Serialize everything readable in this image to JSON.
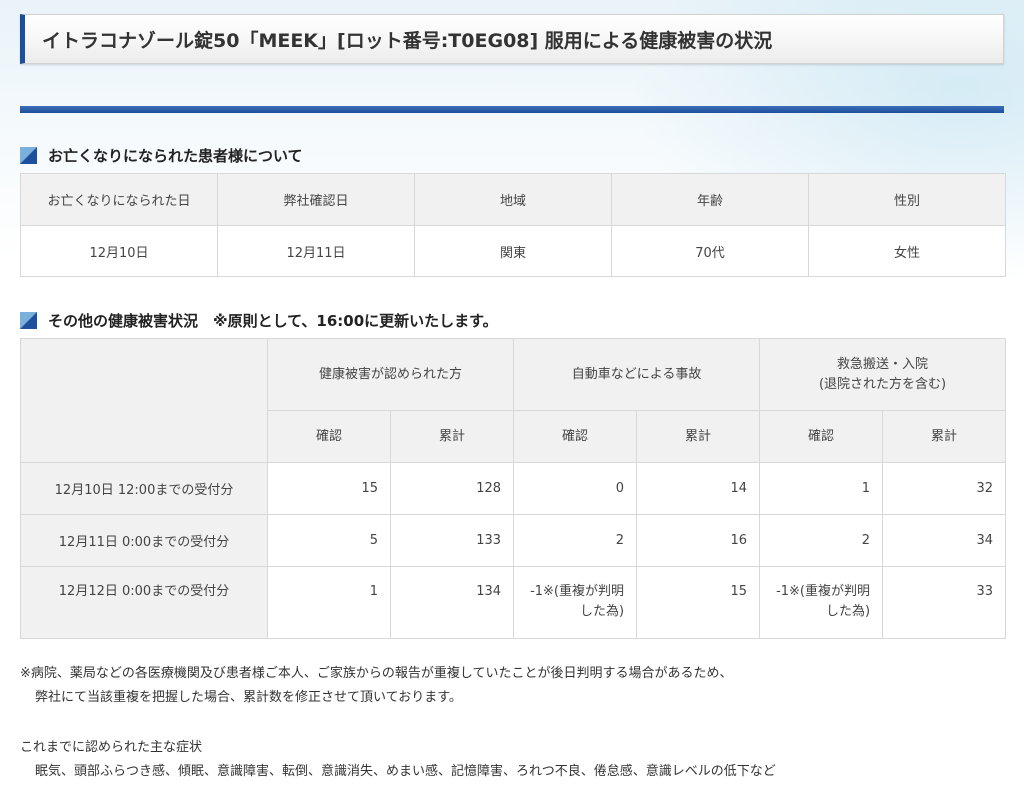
{
  "title": "イトラコナゾール錠50「MEEK」[ロット番号:T0EG08] 服用による健康被害の状況",
  "section1": {
    "heading": "お亡くなりになられた患者様について",
    "headers": [
      "お亡くなりになられた日",
      "弊社確認日",
      "地域",
      "年齢",
      "性別"
    ],
    "row": [
      "12月10日",
      "12月11日",
      "関東",
      "70代",
      "女性"
    ]
  },
  "section2": {
    "heading": "その他の健康被害状況　※原則として、16:00に更新いたします。",
    "groups": [
      "健康被害が認められた方",
      "自動車などによる事故",
      "救急搬送・入院\n(退院された方を含む)"
    ],
    "sub": [
      "確認",
      "累計",
      "確認",
      "累計",
      "確認",
      "累計"
    ],
    "rows": [
      {
        "label": "12月10日 12:00までの受付分",
        "values": [
          "15",
          "128",
          "0",
          "14",
          "1",
          "32"
        ]
      },
      {
        "label": "12月11日 0:00までの受付分",
        "values": [
          "5",
          "133",
          "2",
          "16",
          "2",
          "34"
        ]
      },
      {
        "label": "12月12日 0:00までの受付分",
        "values": [
          "1",
          "134",
          "-1※(重複が判明\nした為)",
          "15",
          "-1※(重複が判明\nした為)",
          "33"
        ]
      }
    ]
  },
  "notes": {
    "line1": "※病院、薬局などの各医療機関及び患者様ご本人、ご家族からの報告が重複していたことが後日判明する場合があるため、",
    "line2": "弊社にて当該重複を把握した場合、累計数を修正させて頂いております。",
    "symptoms_heading": "これまでに認められた主な症状",
    "symptoms": "眠気、頭部ふらつき感、傾眠、意識障害、転倒、意識消失、めまい感、記憶障害、ろれつ不良、倦怠感、意識レベルの低下など"
  }
}
